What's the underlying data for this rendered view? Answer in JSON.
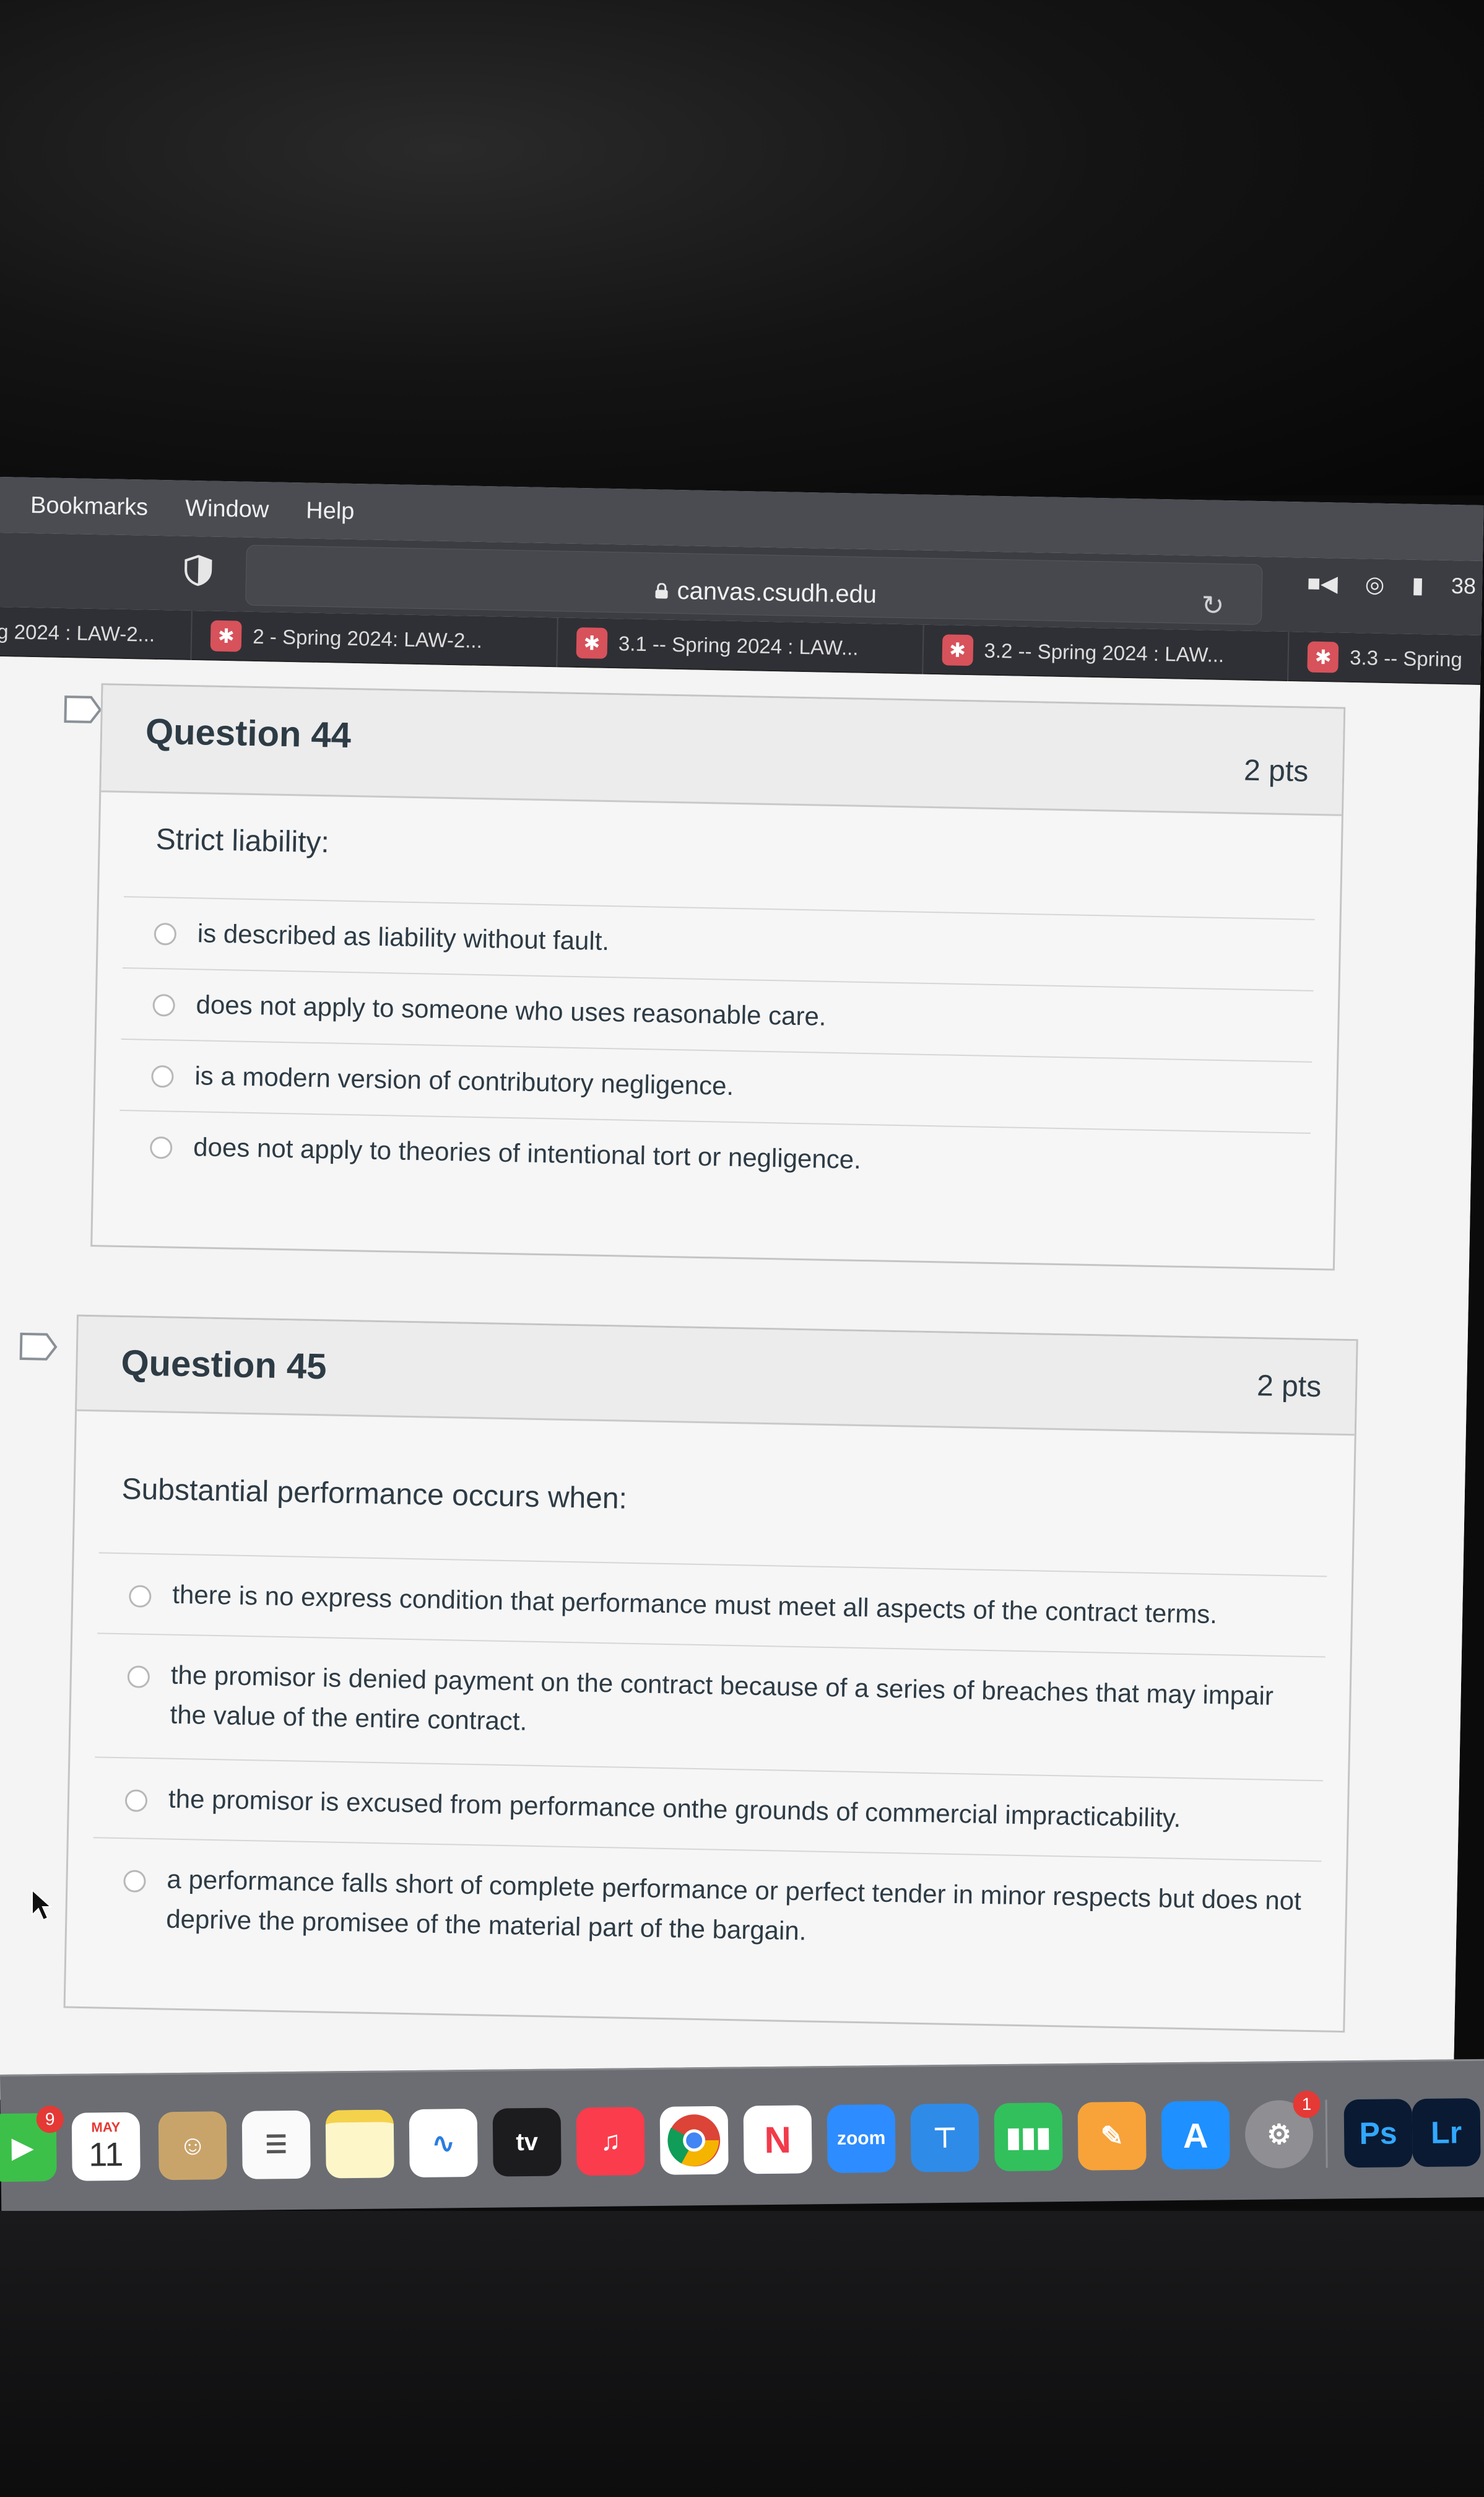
{
  "menu": [
    "Bookmarks",
    "Window",
    "Help"
  ],
  "toolbar": {
    "url": "canvas.csudh.edu",
    "right_text": "38"
  },
  "tabs": [
    "g 2024 : LAW-2...",
    "2 - Spring 2024: LAW-2...",
    "3.1 -- Spring 2024 : LAW...",
    "3.2 -- Spring 2024 : LAW...",
    "3.3 -- Spring"
  ],
  "questions": [
    {
      "title": "Question 44",
      "points": "2 pts",
      "prompt": "Strict liability:",
      "answers": [
        "is described as liability without fault.",
        "does not apply to someone who uses reasonable care.",
        "is a modern version of contributory negligence.",
        "does not apply to theories of intentional tort or negligence."
      ]
    },
    {
      "title": "Question 45",
      "points": "2 pts",
      "prompt": "Substantial performance occurs when:",
      "answers": [
        "there is no express condition that performance must meet all aspects of the contract terms.",
        "the promisor is denied payment on the contract because of a series of breaches that may impair the value of the entire contract.",
        "the promisor is excused from performance onthe grounds of commercial impracticability.",
        "a performance falls short of complete performance or perfect tender in minor respects but does not deprive the promisee of the material part of the bargain."
      ]
    }
  ],
  "dock": {
    "facetime_badge": "9",
    "calendar_month": "MAY",
    "calendar_day": "11",
    "tv_label": "tv",
    "zoom_label": "zoom",
    "settings_badge": "1",
    "ps_label": "Ps",
    "lr_label": "Lr"
  }
}
